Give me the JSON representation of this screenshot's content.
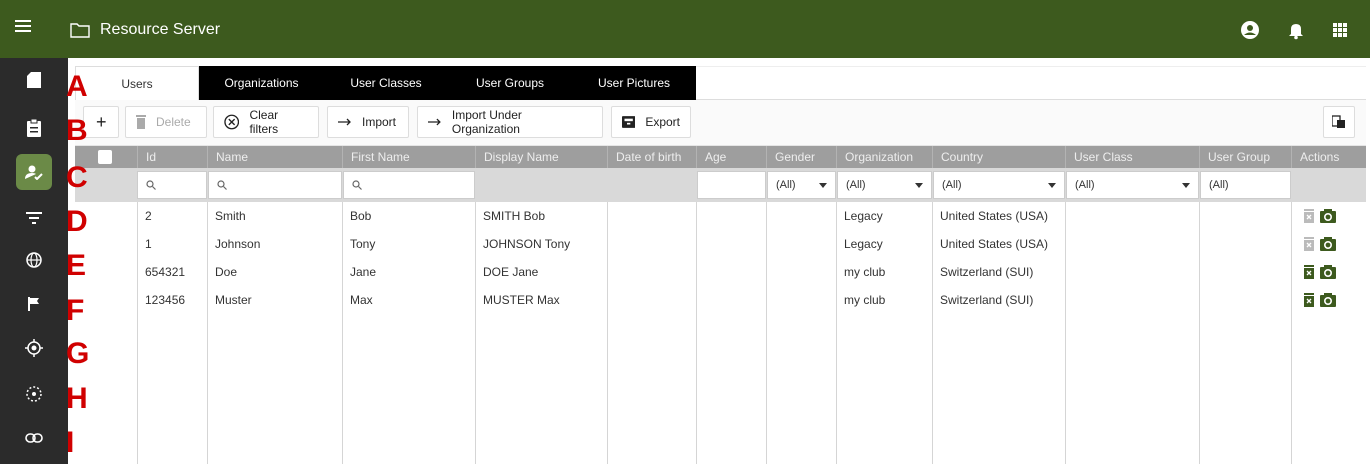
{
  "app": {
    "title": "Resource Server"
  },
  "tabs": [
    {
      "label": "Users",
      "active": true
    },
    {
      "label": "Organizations",
      "active": false
    },
    {
      "label": "User Classes",
      "active": false
    },
    {
      "label": "User Groups",
      "active": false
    },
    {
      "label": "User Pictures",
      "active": false
    }
  ],
  "toolbar": {
    "add_label": "+",
    "delete_label": "Delete",
    "clear_filters_label": "Clear filters",
    "import_label": "Import",
    "import_org_label": "Import Under Organization",
    "export_label": "Export"
  },
  "columns": [
    "Id",
    "Name",
    "First Name",
    "Display Name",
    "Date of birth",
    "Age",
    "Gender",
    "Organization",
    "Country",
    "User Class",
    "User Group",
    "Actions"
  ],
  "filters": {
    "gender": "(All)",
    "organization": "(All)",
    "country": "(All)",
    "user_class": "(All)",
    "user_group": "(All)"
  },
  "rows": [
    {
      "id": "2",
      "name": "Smith",
      "first": "Bob",
      "display": "SMITH Bob",
      "org": "Legacy",
      "country": "United States (USA)",
      "deletable": false
    },
    {
      "id": "1",
      "name": "Johnson",
      "first": "Tony",
      "display": "JOHNSON Tony",
      "org": "Legacy",
      "country": "United States (USA)",
      "deletable": false
    },
    {
      "id": "654321",
      "name": "Doe",
      "first": "Jane",
      "display": "DOE Jane",
      "org": "my club",
      "country": "Switzerland (SUI)",
      "deletable": true
    },
    {
      "id": "123456",
      "name": "Muster",
      "first": "Max",
      "display": "MUSTER Max",
      "org": "my club",
      "country": "Switzerland (SUI)",
      "deletable": true
    }
  ],
  "annotations": [
    "A",
    "B",
    "C",
    "D",
    "E",
    "F",
    "G",
    "H",
    "I"
  ],
  "colors": {
    "brand": "#3d5a1e",
    "sidebar": "#2b2b2b",
    "active_side": "#6b8a47",
    "annotation": "#d00000"
  },
  "sidebar_icons": [
    "sd-card-icon",
    "clipboard-icon",
    "user-check-icon",
    "filter-icon",
    "globe-icon",
    "flag-icon",
    "crosshair-icon",
    "dotted-circle-icon",
    "link-icon"
  ]
}
